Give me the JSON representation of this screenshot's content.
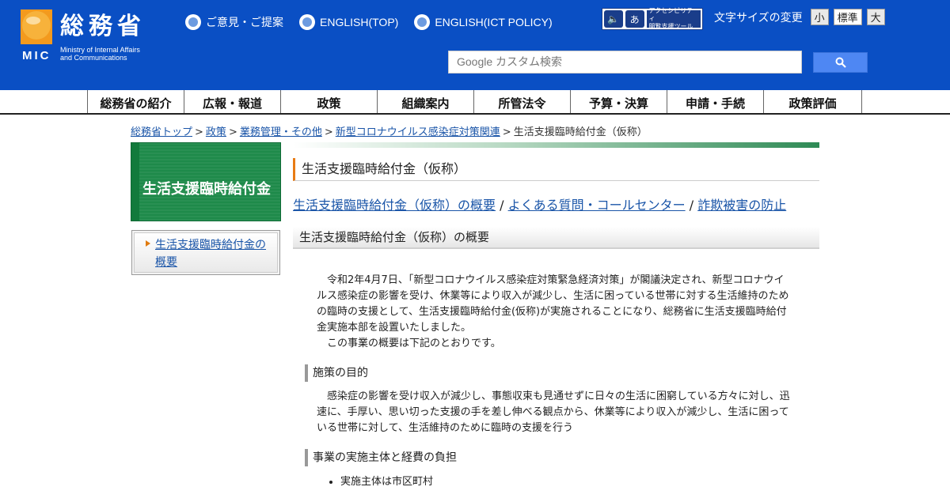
{
  "header": {
    "logo_jp": "総務省",
    "logo_mic": "MIC",
    "logo_en_line1": "Ministry of Internal Affairs",
    "logo_en_line2": "and Communications",
    "top_links": [
      "ご意見・ご提案",
      "ENGLISH(TOP)",
      "ENGLISH(ICT POLICY)"
    ],
    "accessibility_line1": "アクセシビリティ",
    "accessibility_line2": "閲覧支援ツール",
    "font_size_label": "文字サイズの変更",
    "font_size_small": "小",
    "font_size_standard": "標準",
    "font_size_large": "大",
    "search_placeholder": "Google カスタム検索",
    "accent_color": "#0a4fc4"
  },
  "gnav": {
    "items": [
      "総務省の紹介",
      "広報・報道",
      "政策",
      "組織案内",
      "所管法令",
      "予算・決算",
      "申請・手続",
      "政策評価"
    ]
  },
  "breadcrumb": {
    "items": [
      "総務省トップ",
      "政策",
      "業務管理・その他",
      "新型コロナウイルス感染症対策関連"
    ],
    "current": "生活支援臨時給付金（仮称）",
    "separator": ">"
  },
  "sidebar": {
    "title": "生活支援臨時給付金",
    "menu_link": "生活支援臨時給付金の概要"
  },
  "main": {
    "page_title": "生活支援臨時給付金（仮称）",
    "anchor_links": [
      "生活支援臨時給付金（仮称）の概要",
      "よくある質問・コールセンター",
      "詐欺被害の防止"
    ],
    "anchor_separator": "/",
    "section_title": "生活支援臨時給付金（仮称）の概要",
    "intro_paragraph": "令和2年4月7日、「新型コロナウイルス感染症対策緊急経済対策」が閣議決定され、新型コロナウイルス感染症の影響を受け、休業等により収入が減少し、生活に困っている世帯に対する生活維持のための臨時の支援として、生活支援臨時給付金(仮称)が実施されることになり、総務省に生活支援臨時給付金実施本部を設置いたしました。",
    "intro_paragraph2": "この事業の概要は下記のとおりです。",
    "purpose_heading": "施策の目的",
    "purpose_text": "感染症の影響を受け収入が減少し、事態収束も見通せずに日々の生活に困窮している方々に対し、迅速に、手厚い、思い切った支援の手を差し伸べる観点から、休業等により収入が減少し、生活に困っている世帯に対して、生活維持のために臨時の支援を行う",
    "entity_heading": "事業の実施主体と経費の負担",
    "entity_list": [
      "実施主体は市区町村"
    ]
  }
}
